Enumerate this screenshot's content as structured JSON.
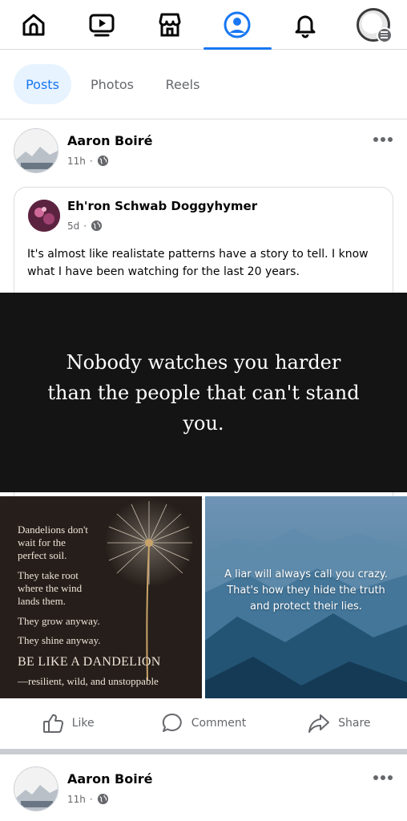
{
  "nav": {
    "items": [
      {
        "icon": "home-icon"
      },
      {
        "icon": "video-icon"
      },
      {
        "icon": "marketplace-icon"
      },
      {
        "icon": "profile-icon",
        "active": true
      },
      {
        "icon": "notifications-icon"
      },
      {
        "icon": "menu-avatar-icon"
      }
    ],
    "accent": "#1877f2"
  },
  "filters": {
    "tabs": [
      "Posts",
      "Photos",
      "Reels"
    ],
    "active": "Posts"
  },
  "post1": {
    "author": "Aaron Boiré",
    "time": "11h",
    "shared": {
      "author": "Eh'ron Schwab Doggyhymer",
      "time": "5d",
      "text": "It's almost like realistate patterns have a story to tell. I know what I have been watching for the last 20 years.",
      "quote": "Nobody watches you harder than the people that can't stand you.",
      "image_left": {
        "lines": [
          "Dandelions don't",
          "wait for the",
          "perfect soil.",
          "They take root",
          "where the wind",
          "lands them.",
          "They grow anyway.",
          "They shine anyway.",
          "BE LIKE A DANDELION",
          "—resilient, wild, and unstoppable"
        ]
      },
      "image_right": {
        "text": "A liar will always call you crazy. That's how they hide the truth and protect their lies."
      }
    },
    "actions": {
      "like": "Like",
      "comment": "Comment",
      "share": "Share"
    }
  },
  "post2": {
    "author": "Aaron Boiré",
    "time": "11h"
  }
}
